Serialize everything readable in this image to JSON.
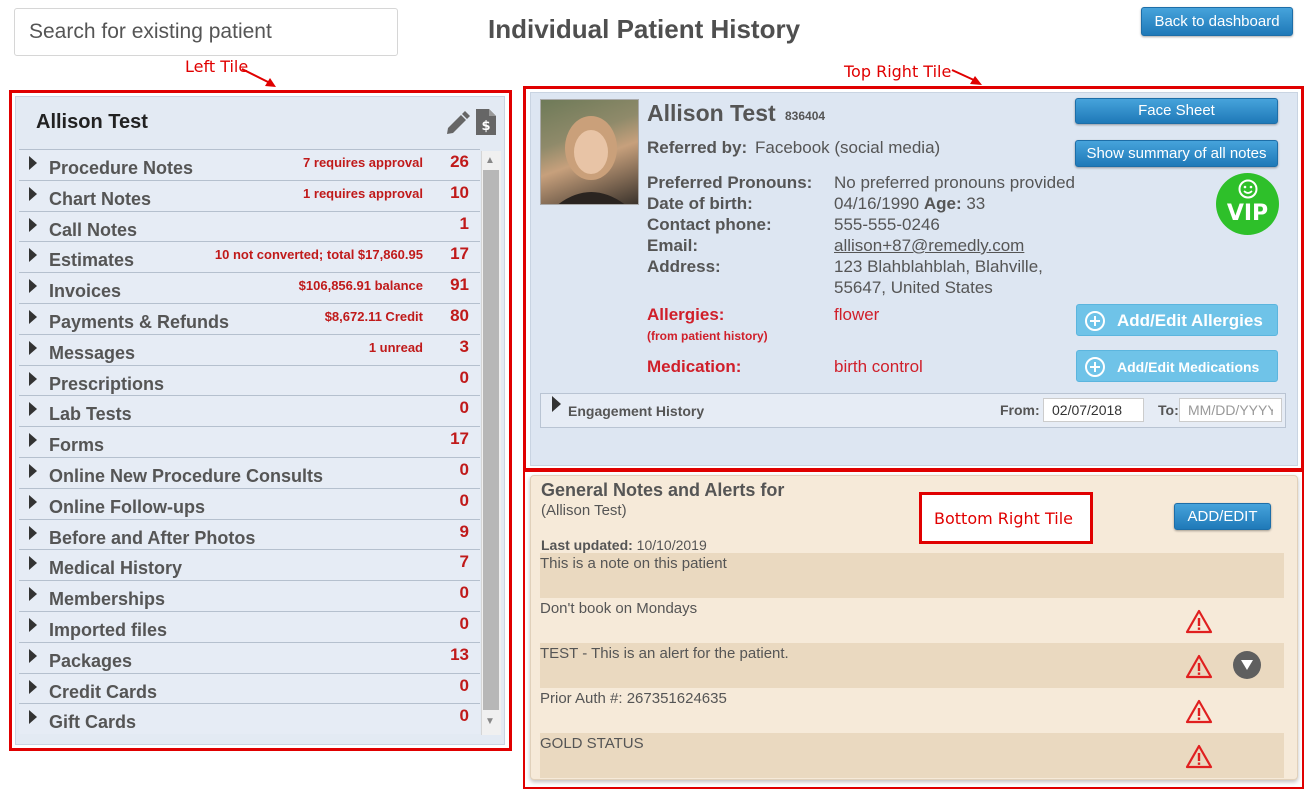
{
  "header": {
    "search_placeholder": "Search for existing patient",
    "title": "Individual Patient History",
    "back_button": "Back to dashboard"
  },
  "annotations": {
    "left": "Left Tile",
    "top_right": "Top Right Tile",
    "bottom_right": "Bottom Right Tile"
  },
  "left_tile": {
    "patient_name": "Allison Test",
    "icons": [
      "pencil-icon",
      "dollar-document-icon"
    ],
    "items": [
      {
        "label": "Procedure Notes",
        "note": "7 requires approval",
        "count": "26"
      },
      {
        "label": "Chart Notes",
        "note": "1 requires approval",
        "count": "10"
      },
      {
        "label": "Call Notes",
        "note": "",
        "count": "1"
      },
      {
        "label": "Estimates",
        "note": "10 not converted; total $17,860.95",
        "count": "17"
      },
      {
        "label": "Invoices",
        "note": "$106,856.91 balance",
        "count": "91"
      },
      {
        "label": "Payments & Refunds",
        "note": "$8,672.11 Credit",
        "count": "80"
      },
      {
        "label": "Messages",
        "note": "1 unread",
        "count": "3"
      },
      {
        "label": "Prescriptions",
        "note": "",
        "count": "0"
      },
      {
        "label": "Lab Tests",
        "note": "",
        "count": "0"
      },
      {
        "label": "Forms",
        "note": "",
        "count": "17"
      },
      {
        "label": "Online New Procedure Consults",
        "note": "",
        "count": "0"
      },
      {
        "label": "Online Follow-ups",
        "note": "",
        "count": "0"
      },
      {
        "label": "Before and After Photos",
        "note": "",
        "count": "9"
      },
      {
        "label": "Medical History",
        "note": "",
        "count": "7"
      },
      {
        "label": "Memberships",
        "note": "",
        "count": "0"
      },
      {
        "label": "Imported files",
        "note": "",
        "count": "0"
      },
      {
        "label": "Packages",
        "note": "",
        "count": "13"
      },
      {
        "label": "Credit Cards",
        "note": "",
        "count": "0"
      },
      {
        "label": "Gift Cards",
        "note": "",
        "count": "0"
      }
    ]
  },
  "top_right": {
    "name": "Allison Test",
    "patient_id": "836404",
    "referred_label": "Referred by:",
    "referred_value": "Facebook (social media)",
    "pronouns_label": "Preferred Pronouns:",
    "pronouns_value": "No preferred pronouns provided",
    "dob_label": "Date of birth:",
    "dob_value": "04/16/1990",
    "age_label": "Age:",
    "age_value": "33",
    "phone_label": "Contact phone:",
    "phone_value": "555-555-0246",
    "email_label": "Email:",
    "email_value": "allison+87@remedly.com",
    "address_label": "Address:",
    "address_line1": "123 Blahblahblah, Blahville,",
    "address_line2": "55647, United States",
    "allergies_label": "Allergies:",
    "allergies_sub": "(from patient history)",
    "allergies_value": "flower",
    "medication_label": "Medication:",
    "medication_value": "birth control",
    "face_sheet_button": "Face Sheet",
    "summary_button": "Show summary of all notes",
    "vip_badge": "VIP",
    "add_allergies_button": "Add/Edit Allergies",
    "add_medications_button": "Add/Edit Medications",
    "engagement_label": "Engagement History",
    "from_label": "From:",
    "from_value": "02/07/2018",
    "to_label": "To:",
    "to_placeholder": "MM/DD/YYYY"
  },
  "bottom_right": {
    "title": "General Notes and Alerts for",
    "subtitle": "(Allison Test)",
    "add_edit_button": "ADD/EDIT",
    "last_updated_label": "Last updated:",
    "last_updated_value": "10/10/2019",
    "notes": [
      {
        "text": "This is a note on this patient",
        "alert": false
      },
      {
        "text": "Don't book on Mondays",
        "alert": true
      },
      {
        "text": "TEST - This is an alert for the patient.",
        "alert": true
      },
      {
        "text": "Prior Auth #: 267351624635",
        "alert": true
      },
      {
        "text": "GOLD STATUS",
        "alert": true
      }
    ]
  },
  "colors": {
    "accent_blue": "#1f79b8",
    "alert_red": "#d01f2a",
    "vip_green": "#2ec02a",
    "annotation_red": "#e00000"
  }
}
